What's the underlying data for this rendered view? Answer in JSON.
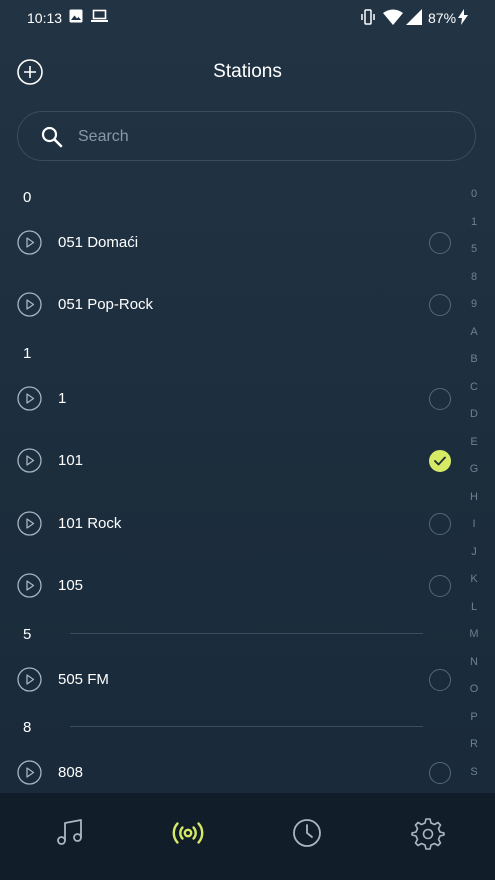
{
  "status_bar": {
    "time": "10:13",
    "battery": "87%"
  },
  "header": {
    "title": "Stations"
  },
  "search": {
    "placeholder": "Search"
  },
  "sections": [
    {
      "label": "0",
      "stations": [
        {
          "name": "051 Domaći",
          "selected": false
        },
        {
          "name": "051 Pop-Rock",
          "selected": false
        }
      ]
    },
    {
      "label": "1",
      "stations": [
        {
          "name": "1",
          "selected": false
        },
        {
          "name": "101",
          "selected": true
        },
        {
          "name": "101 Rock",
          "selected": false
        },
        {
          "name": "105",
          "selected": false
        }
      ]
    },
    {
      "label": "5",
      "stations": [
        {
          "name": "505 FM",
          "selected": false
        }
      ]
    },
    {
      "label": "8",
      "stations": [
        {
          "name": "808",
          "selected": false
        }
      ]
    }
  ],
  "alpha_index": [
    "0",
    "1",
    "5",
    "8",
    "9",
    "A",
    "B",
    "C",
    "D",
    "E",
    "G",
    "H",
    "I",
    "J",
    "K",
    "L",
    "M",
    "N",
    "O",
    "P",
    "R",
    "S"
  ],
  "bottom_nav": [
    {
      "icon": "music-note-icon",
      "active": false
    },
    {
      "icon": "radio-broadcast-icon",
      "active": true
    },
    {
      "icon": "clock-icon",
      "active": false
    },
    {
      "icon": "gear-icon",
      "active": false
    }
  ],
  "colors": {
    "accent": "#d6ea66",
    "background": "#1f3141",
    "nav_background": "#111d28"
  }
}
